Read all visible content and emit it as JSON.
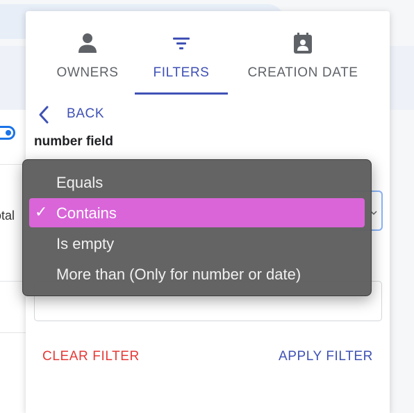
{
  "background": {
    "cell_text": "otal"
  },
  "tabs": [
    {
      "label": "OWNERS",
      "icon": "person-icon"
    },
    {
      "label": "FILTERS",
      "icon": "filter-icon",
      "active": true
    },
    {
      "label": "CREATION DATE",
      "icon": "calendar-icon"
    }
  ],
  "back": {
    "label": "BACK",
    "icon": "chevron-left-icon"
  },
  "field": {
    "title": "number field"
  },
  "dropdown": {
    "options": [
      {
        "label": "Equals",
        "selected": false
      },
      {
        "label": "Contains",
        "selected": true
      },
      {
        "label": "Is empty",
        "selected": false
      },
      {
        "label": "More than (Only for number or date)",
        "selected": false
      }
    ],
    "check_glyph": "✓",
    "selected_color": "#d965d9"
  },
  "actions": {
    "clear_label": "CLEAR FILTER",
    "apply_label": "APPLY FILTER"
  },
  "colors": {
    "accent": "#3f51b5",
    "danger": "#e53935"
  }
}
